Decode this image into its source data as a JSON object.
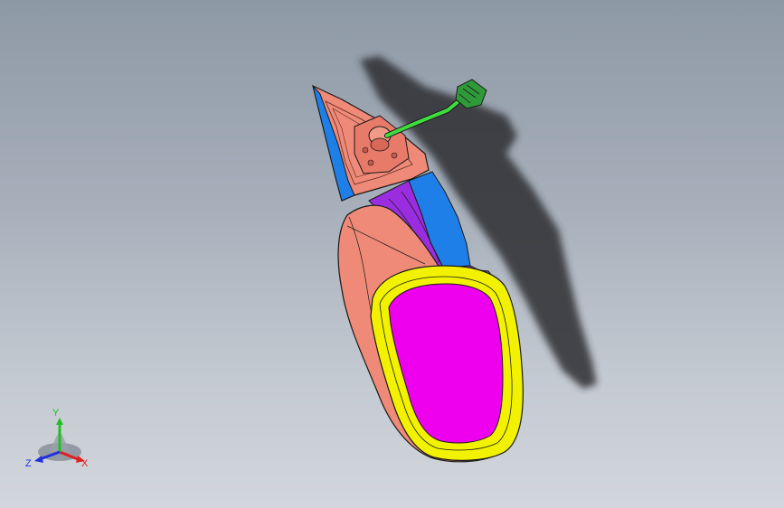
{
  "viewport": {
    "model": "side-mirror-assembly",
    "colors": {
      "housing": "#f08a78",
      "mirror_glass": "#ee00ee",
      "glass_frame": "#f2f200",
      "arm_purple": "#9b2de0",
      "arm_blue": "#1f7fe8",
      "cable": "#3fdc3f",
      "connector": "#2f9a3a",
      "shadow": "#2e2e30",
      "outline": "#1a1a1a"
    }
  },
  "triad": {
    "x_label": "X",
    "y_label": "Y",
    "z_label": "Z",
    "x_color": "#e02020",
    "y_color": "#20c020",
    "z_color": "#2030e0"
  }
}
